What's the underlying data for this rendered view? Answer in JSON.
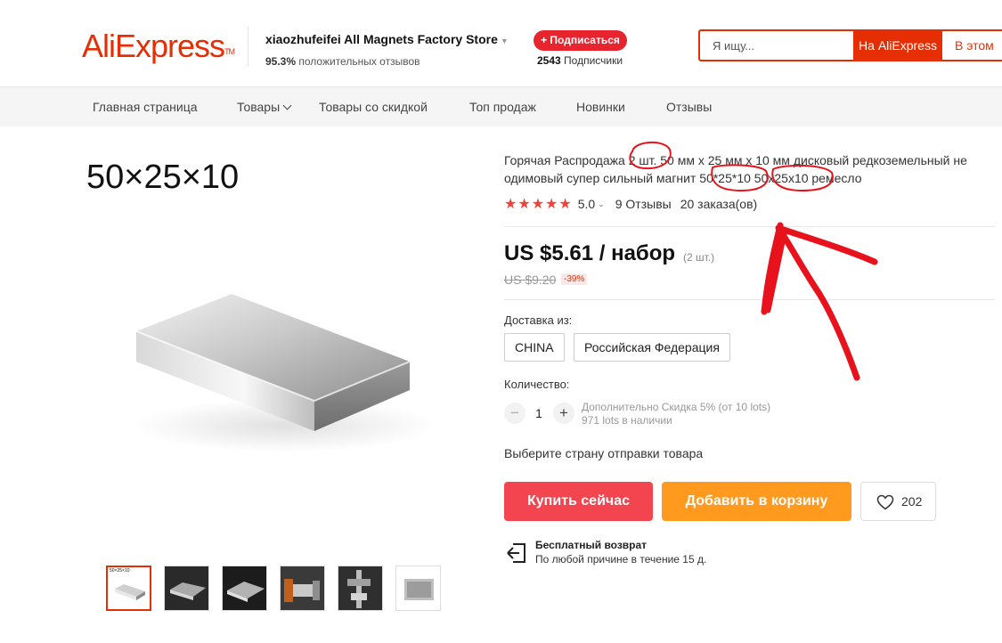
{
  "header": {
    "logo": "AliExpress",
    "logo_tm": "TM",
    "store_name": "xiaozhufeifei All Magnets Factory Store",
    "store_rating_pct": "95.3%",
    "store_rating_text": "положительных отзывов",
    "follow_label": "+ Подписаться",
    "subscribers_count": "2543",
    "subscribers_label": "Подписчики",
    "search_placeholder": "Я ищу...",
    "search_btn_aliexpress": "На AliExpress",
    "search_btn_store": "В этом"
  },
  "nav": {
    "items": [
      "Главная страница",
      "Товары",
      "Товары со скидкой",
      "Топ продаж",
      "Новинки",
      "Отзывы"
    ]
  },
  "gallery": {
    "image_caption": "50×25×10",
    "thumb_caption": "50×25×10",
    "thumbs": [
      "magnet-white",
      "magnet-dark-1",
      "magnet-dark-2",
      "magnet-caliper-1",
      "magnet-caliper-2",
      "magnet-pack"
    ]
  },
  "product": {
    "title": "Горячая Распродажа 2 шт. 50 мм х 25 мм х 10 мм дисковый редкоземельный не одимовый супер сильный магнит 50*25*10 50x25x10 ремесло",
    "rating": "5.0",
    "reviews": "9 Отзывы",
    "orders": "20 заказа(ов)",
    "price": "US $5.61 / набор",
    "price_unit": "(2 шт.)",
    "old_price": "US $9.20",
    "discount": "-39%",
    "ship_from_label": "Доставка из:",
    "ship_options": [
      "CHINA",
      "Российская Федерация"
    ],
    "quantity_label": "Количество:",
    "quantity": "1",
    "quantity_minus": "−",
    "quantity_plus": "+",
    "bulk_discount": "Дополнительно Скидка 5% (от 10 lots)",
    "stock": "971 lots в наличии",
    "ship_prompt": "Выберите страну отправки товара",
    "buy_now": "Купить сейчас",
    "add_to_cart": "Добавить в корзину",
    "wishlist_count": "202",
    "return_title": "Бесплатный возврат",
    "return_subtitle": "По любой причине в течение 15 д."
  },
  "colors": {
    "brand": "#e62e04",
    "buy_button": "#f2454f",
    "cart_button": "#ff9a1f",
    "stars": "#f0433a",
    "annotation": "#e8121c"
  }
}
